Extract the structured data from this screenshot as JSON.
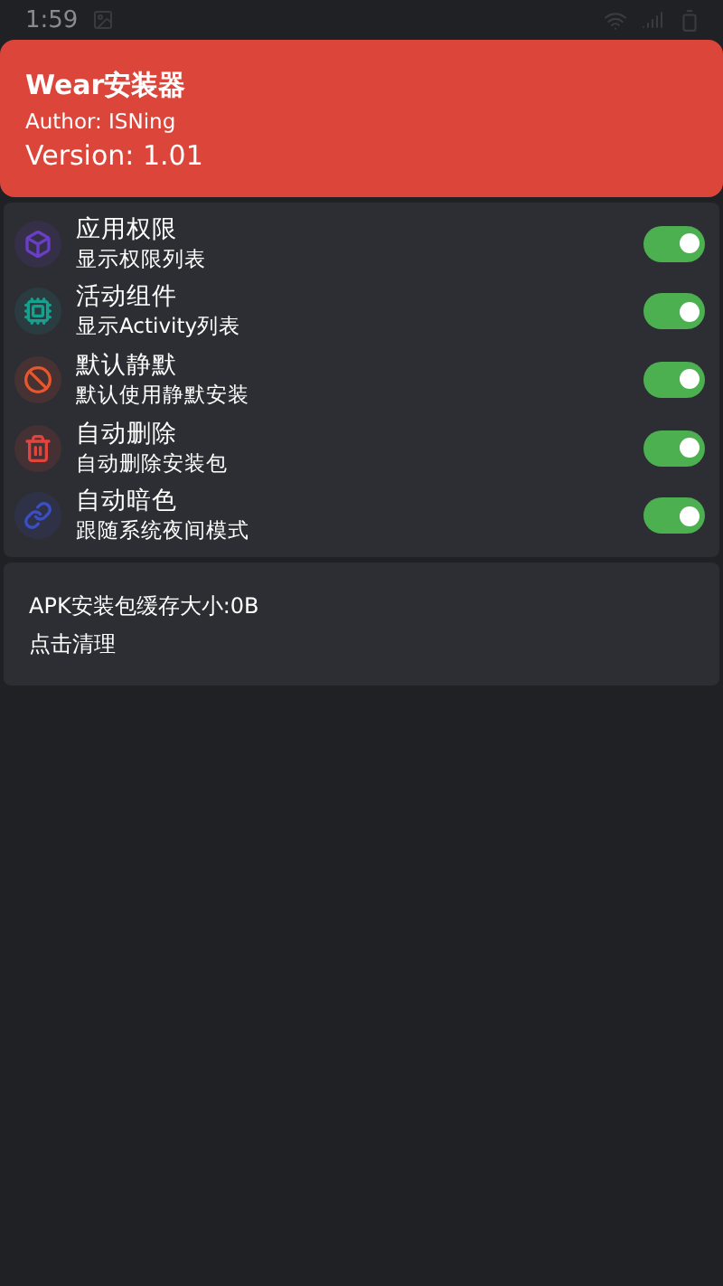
{
  "status_bar": {
    "time": "1:59"
  },
  "header": {
    "title": "Wear安装器",
    "author": "Author: ISNing",
    "version": "Version: 1.01"
  },
  "settings": [
    {
      "kind": "cube",
      "title": "应用权限",
      "subtitle": "显示权限列表",
      "on": true,
      "color": "#6a3fc8"
    },
    {
      "kind": "chip",
      "title": "活动组件",
      "subtitle": "显示Activity列表",
      "on": true,
      "color": "#16a08e"
    },
    {
      "kind": "ban",
      "title": "默认静默",
      "subtitle": "默认使用静默安装",
      "on": true,
      "color": "#e8562c"
    },
    {
      "kind": "trash",
      "title": "自动删除",
      "subtitle": "自动删除安装包",
      "on": true,
      "color": "#e0443c"
    },
    {
      "kind": "link",
      "title": "自动暗色",
      "subtitle": "跟随系统夜间模式",
      "on": true,
      "color": "#3b4fc4"
    }
  ],
  "cache": {
    "size": "APK安装包缓存大小:0B",
    "action": "点击清理"
  }
}
